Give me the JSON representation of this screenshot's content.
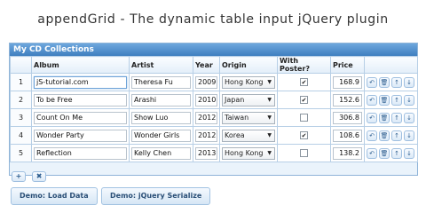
{
  "page": {
    "title": "appendGrid - The dynamic table input jQuery plugin"
  },
  "grid": {
    "caption": "My CD Collections",
    "columns": [
      "",
      "Album",
      "Artist",
      "Year",
      "Origin",
      "With Poster?",
      "Price",
      ""
    ],
    "rows": [
      {
        "num": "1",
        "album": "jS-tutorial.com",
        "artist": "Theresa Fu",
        "year": "2009",
        "origin": "Hong Kong",
        "poster": true,
        "price": "168.9"
      },
      {
        "num": "2",
        "album": "To be Free",
        "artist": "Arashi",
        "year": "2010",
        "origin": "Japan",
        "poster": true,
        "price": "152.6"
      },
      {
        "num": "3",
        "album": "Count On Me",
        "artist": "Show Luo",
        "year": "2012",
        "origin": "Taiwan",
        "poster": false,
        "price": "306.8"
      },
      {
        "num": "4",
        "album": "Wonder Party",
        "artist": "Wonder Girls",
        "year": "2012",
        "origin": "Korea",
        "poster": true,
        "price": "108.6"
      },
      {
        "num": "5",
        "album": "Reflection",
        "artist": "Kelly Chen",
        "year": "2013",
        "origin": "Hong Kong",
        "poster": false,
        "price": "138.2"
      }
    ],
    "row_actions": [
      "insert-icon",
      "remove-icon",
      "move-up-icon",
      "move-down-icon"
    ],
    "row_action_glyphs": [
      "↶",
      "🗑",
      "↑",
      "↓"
    ],
    "footer_actions": {
      "append": "+",
      "remove_last": "✖"
    }
  },
  "buttons": {
    "load_data": "Demo: Load Data",
    "serialize": "Demo: jQuery Serialize"
  },
  "colors": {
    "caption_bg": "#4a8ccb",
    "border": "#8fb4d8",
    "button_text": "#2a4f77"
  }
}
